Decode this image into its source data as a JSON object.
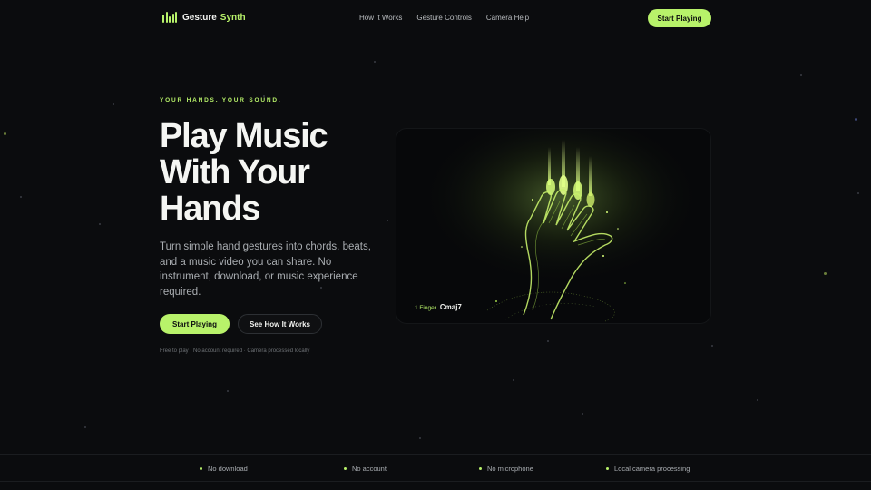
{
  "brand": {
    "word1": "Gesture",
    "word2": "Synth"
  },
  "nav": {
    "items": [
      "How It Works",
      "Gesture Controls",
      "Camera Help"
    ]
  },
  "header": {
    "cta_label": "Start Playing"
  },
  "hero": {
    "eyebrow": "YOUR HANDS. YOUR SOUND.",
    "headline_lines": [
      "Play Music",
      "With Your",
      "Hands"
    ],
    "subtitle": "Turn simple hand gestures into chords, beats, and a music video you can share. No instrument, download, or music experience required.",
    "primary_cta": "Start Playing",
    "secondary_cta": "See How It Works",
    "fineprint": "Free to play · No account required · Camera processed locally"
  },
  "visual": {
    "finger_label": "1 Finger",
    "chord_label": "Cmaj7"
  },
  "features": [
    "No download",
    "No account",
    "No microphone",
    "Local camera processing"
  ],
  "colors": {
    "accent": "#b8f26a",
    "background": "#0b0c0e"
  }
}
